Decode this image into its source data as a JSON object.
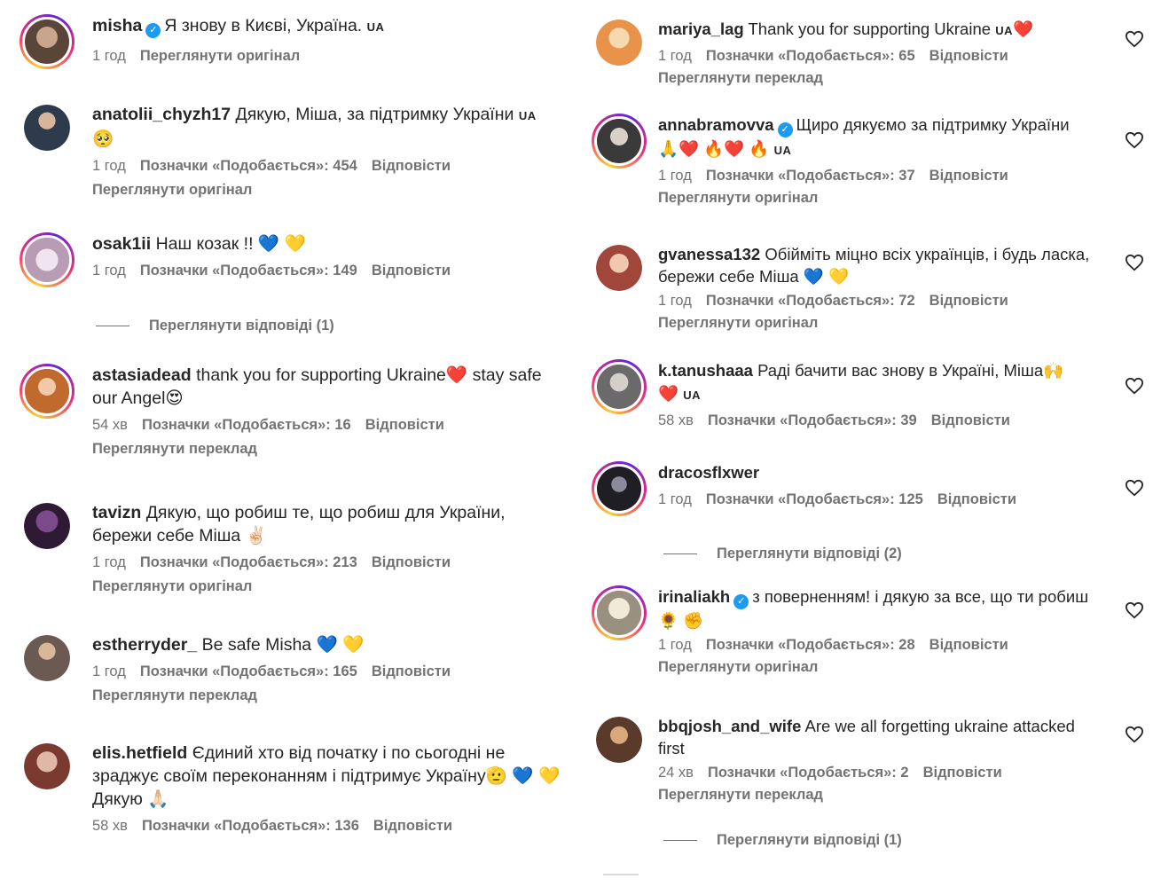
{
  "left": [
    {
      "user": "misha",
      "verified": true,
      "text": "Я знову в Києві, Україна.",
      "ua": "UA",
      "time": "1 год",
      "likes": "",
      "reply": "",
      "link": "Переглянути оригінал",
      "avatar_color": "#6b5a4e",
      "ring": true
    },
    {
      "user": "anatolii_chyzh17",
      "verified": false,
      "text": "Дякую, Міша, за підтримку України",
      "ua": "UA",
      "emoji_line": "🥺",
      "time": "1 год",
      "likes": "Позначки «Подобається»: 454",
      "reply": "Відповісти",
      "link": "Переглянути оригінал",
      "avatar_color": "#3a4a5c",
      "ring": false
    },
    {
      "user": "osak1ii",
      "verified": false,
      "text": "Наш козак !!",
      "emojis": "💙 💛",
      "time": "1 год",
      "likes": "Позначки «Подобається»: 149",
      "reply": "Відповісти",
      "link": "",
      "replies": "Переглянути відповіді (1)",
      "avatar_color": "#c9b4c8",
      "ring": true
    },
    {
      "user": "astasiadead",
      "verified": false,
      "text": "thank you for supporting Ukraine❤️ stay safe our Angel😍",
      "time": "54 хв",
      "likes": "Позначки «Подобається»: 16",
      "reply": "Відповісти",
      "link": "Переглянути переклад",
      "avatar_color": "#d98a4a",
      "ring": true
    },
    {
      "user": "tavizn",
      "verified": false,
      "text": "Дякую, що робиш те, що робиш для України, бережи себе Міша ✌🏻",
      "time": "1 год",
      "likes": "Позначки «Подобається»: 213",
      "reply": "Відповісти",
      "link": "Переглянути оригінал",
      "avatar_color": "#3b2340",
      "ring": false
    },
    {
      "user": "estherryder_",
      "verified": false,
      "text": "Be safe Misha",
      "emojis": "💙 💛",
      "time": "1 год",
      "likes": "Позначки «Подобається»: 165",
      "reply": "Відповісти",
      "link": "Переглянути переклад",
      "avatar_color": "#6a5a52",
      "ring": false
    },
    {
      "user": "elis.hetfield",
      "verified": false,
      "text": "Єдиний хто від початку і по сьогодні не зраджує своїм переконанням і підтримує Україну🫡 💙 💛",
      "line2": "Дякую 🙏🏻",
      "time": "58 хв",
      "likes": "Позначки «Подобається»: 136",
      "reply": "Відповісти",
      "link": "",
      "avatar_color": "#8a5a50",
      "ring": false
    }
  ],
  "right": [
    {
      "user": "mariya_lag",
      "verified": false,
      "text": "Thank you for supporting Ukraine",
      "ua": "UA",
      "tail": "❤️",
      "time": "1 год",
      "likes": "Позначки «Подобається»: 65",
      "reply": "Відповісти",
      "link": "Переглянути переклад",
      "avatar_color": "#e8a86a",
      "ring": false
    },
    {
      "user": "annabramovva",
      "verified": true,
      "text": "Щиро дякуємо за підтримку України",
      "emoji_line": "🙏❤️ 🔥❤️ 🔥",
      "ua": "UA",
      "time": "1 год",
      "likes": "Позначки «Подобається»: 37",
      "reply": "Відповісти",
      "link": "Переглянути оригінал",
      "avatar_color": "#4a4a4a",
      "ring": true
    },
    {
      "user": "gvanessa132",
      "verified": false,
      "text": "Обійміть міцно всіх українців, і будь ласка, бережи себе Міша 💙 💛",
      "time": "1 год",
      "likes": "Позначки «Подобається»: 72",
      "reply": "Відповісти",
      "link": "Переглянути оригінал",
      "avatar_color": "#a0463a",
      "ring": false
    },
    {
      "user": "k.tanushaaa",
      "verified": false,
      "text": "Раді бачити вас знову в Україні, Міша🙌",
      "emoji_line": "❤️",
      "ua": "UA",
      "time": "58 хв",
      "likes": "Позначки «Подобається»: 39",
      "reply": "Відповісти",
      "link": "",
      "avatar_color": "#7a7a7a",
      "ring": true
    },
    {
      "user": "dracosflxwer",
      "verified": false,
      "text": "",
      "time": "1 год",
      "likes": "Позначки «Подобається»: 125",
      "reply": "Відповісти",
      "link": "",
      "replies": "Переглянути відповіді (2)",
      "avatar_color": "#2a2a30",
      "ring": true
    },
    {
      "user": "irinaliakh",
      "verified": true,
      "text": "з поверненням! і дякую за все, що ти робиш 🌻 ✊",
      "time": "1 год",
      "likes": "Позначки «Подобається»: 28",
      "reply": "Відповісти",
      "link": "Переглянути оригінал",
      "avatar_color": "#cfc7b8",
      "ring": true
    },
    {
      "user": "bbqjosh_and_wife",
      "verified": false,
      "text": "Are we all forgetting ukraine attacked first",
      "time": "24 хв",
      "likes": "Позначки «Подобається»: 2",
      "reply": "Відповісти",
      "link": "Переглянути переклад",
      "replies": "Переглянути відповіді (1)",
      "avatar_color": "#6a4a3a",
      "ring": false
    }
  ]
}
